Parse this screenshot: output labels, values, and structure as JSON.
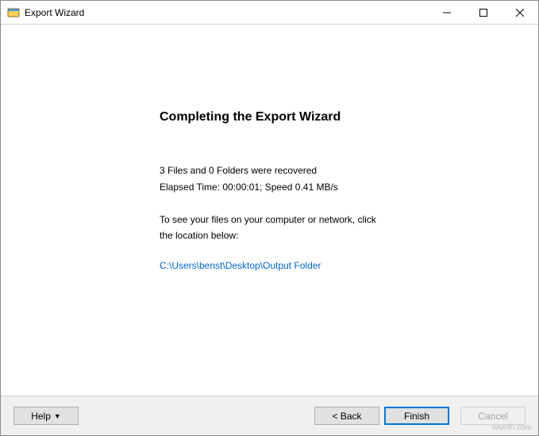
{
  "title": "Export Wizard",
  "heading": "Completing the Export Wizard",
  "status": {
    "line1": "3 Files and 0 Folders were recovered",
    "line2": "Elapsed Time: 00:00:01; Speed 0.41 MB/s"
  },
  "info": {
    "line1": "To see your files on your computer or network, click",
    "line2": "the location below:"
  },
  "output_path": "C:\\Users\\benst\\Desktop\\Output Folder",
  "buttons": {
    "help": "Help",
    "back": "< Back",
    "finish": "Finish",
    "cancel": "Cancel"
  },
  "watermark": "wsxdn.com"
}
